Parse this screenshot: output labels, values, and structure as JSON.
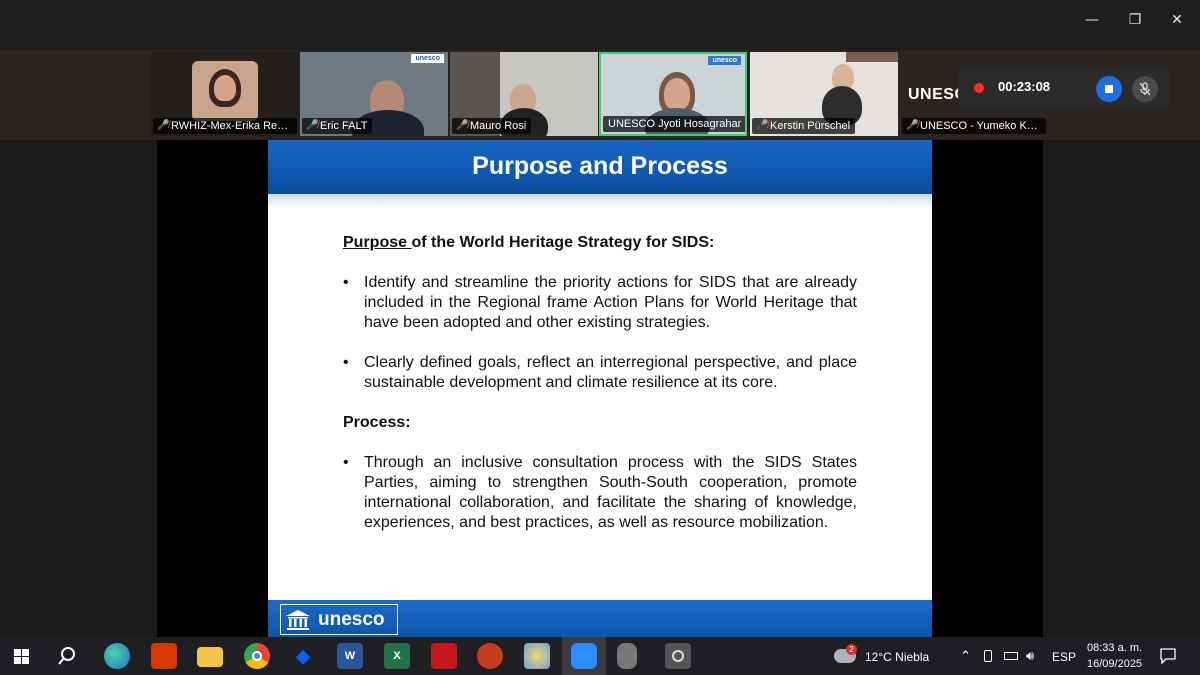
{
  "window": {
    "controls": [
      "—",
      "❐",
      "✕"
    ]
  },
  "participants": [
    {
      "name": "RWHIZ-Mex-Erika Ren...",
      "muted": true
    },
    {
      "name": "Eric FALT",
      "muted": true
    },
    {
      "name": "Mauro Rosi",
      "muted": true
    },
    {
      "name": "UNESCO Jyoti Hosagrahar",
      "muted": false,
      "active": true
    },
    {
      "name": "Kerstin Pürschel",
      "muted": true
    },
    {
      "name": "UNESCO - Yumeko Ka...",
      "muted": true
    }
  ],
  "tile_badge": "unesco",
  "tile_brand_text": "UNESCO",
  "recording": {
    "time": "00:23:08"
  },
  "slide": {
    "title": "Purpose and Process",
    "purpose_heading_underlined": "Purpose ",
    "purpose_heading_rest": "of the World Heritage Strategy for SIDS:",
    "bullets_purpose": [
      "Identify and streamline the priority actions for SIDS that are already included in the Regional frame Action Plans for World Heritage that have been adopted and other existing strategies.",
      "Clearly defined goals, reflect an interregional perspective, and place sustainable development and climate resilience at its core."
    ],
    "process_heading": "Process:",
    "bullets_process": [
      "Through an inclusive consultation process with the SIDS States Parties, aiming to strengthen South-South cooperation, promote international collaboration, and facilitate the sharing of knowledge, experiences, and best practices, as well as resource mobilization."
    ],
    "bullet_char": "•",
    "footer_logo": "unesco"
  },
  "taskbar": {
    "apps": [
      "start",
      "search",
      "edge",
      "office",
      "file-explorer",
      "chrome",
      "dropbox",
      "word",
      "excel",
      "acrobat",
      "powerpoint",
      "paint",
      "zoom",
      "podcast",
      "camera"
    ],
    "word_letter": "W",
    "excel_letter": "X",
    "weather_badge": "2",
    "weather": "12°C  Niebla",
    "language": "ESP",
    "time": "08:33 a. m.",
    "date": "16/09/2025"
  }
}
